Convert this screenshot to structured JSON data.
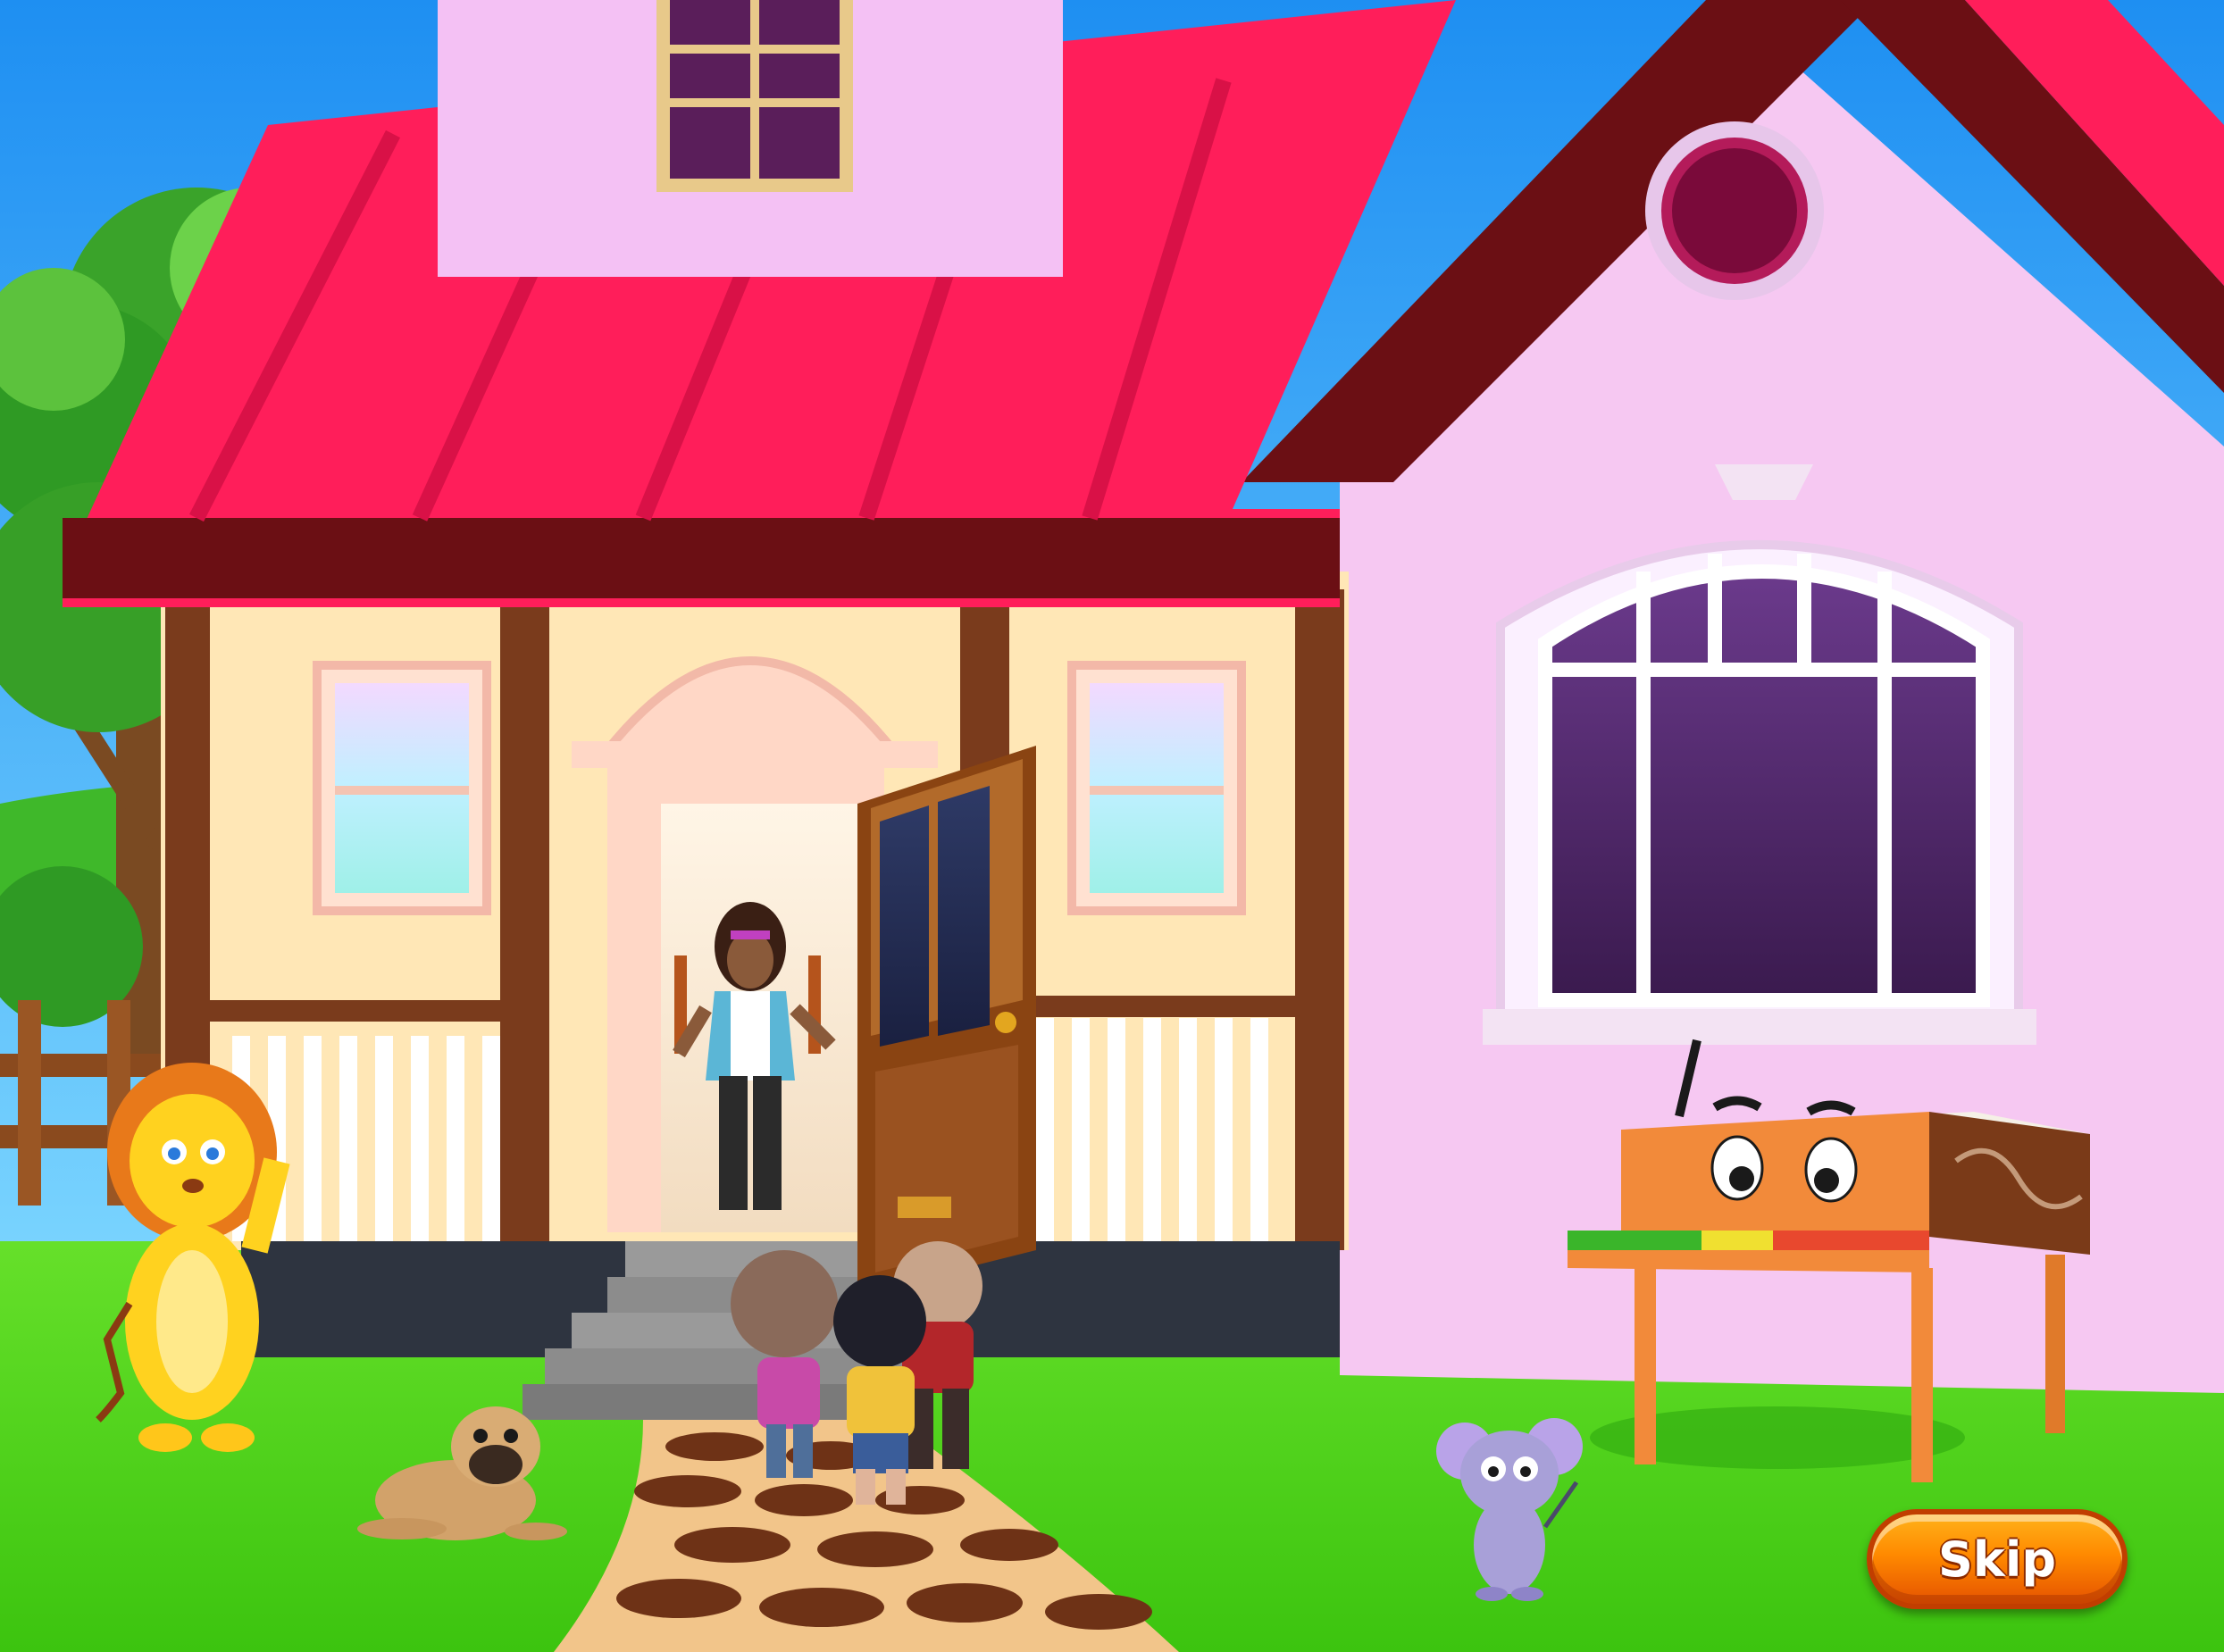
{
  "game": {
    "skip_label": "Skip"
  },
  "scene": {
    "characters": [
      "teacher",
      "lion",
      "dog",
      "mouse",
      "piano",
      "child-girl",
      "child-boy-yellow",
      "child-boy-red"
    ]
  },
  "colors": {
    "sky": "#2aa0f0",
    "grass": "#4fd41c",
    "roof": "#ff1e5a",
    "roof_trim": "#6b0f14",
    "house_wall": "#f6c8f2",
    "porch_wall": "#ffe7b6",
    "door": "#8a4412",
    "skip_button": "#ff8a00"
  }
}
